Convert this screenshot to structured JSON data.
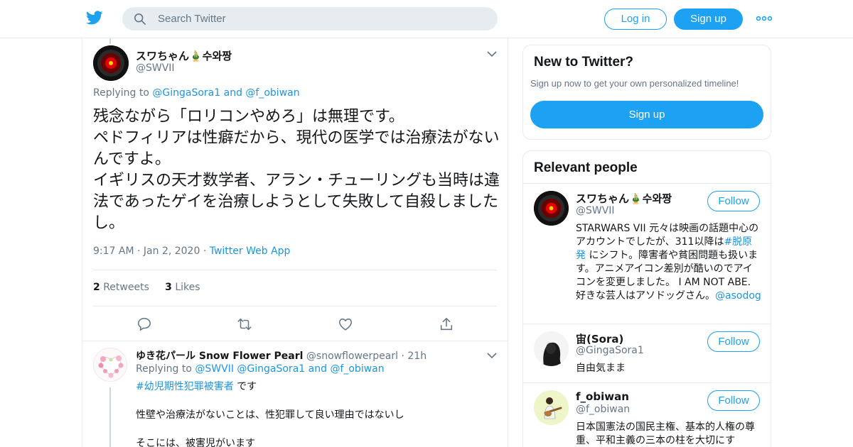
{
  "colors": {
    "accent": "#1da1f2",
    "link": "#1b95e0",
    "muted": "#657786"
  },
  "topbar": {
    "logo_icon": "twitter-bird-icon",
    "search_placeholder": "Search Twitter",
    "login_label": "Log in",
    "signup_label": "Sign up",
    "more_icon": "more-dots-icon"
  },
  "tweet": {
    "name": "スワちゃん🎍수와짱",
    "handle": "@SWVII",
    "replying_prefix": "Replying to",
    "replying_user1": "@GingaSora1",
    "replying_and": "and",
    "replying_user2": "@f_obiwan",
    "text": "残念ながら「ロリコンやめろ」は無理です。\nペドフィリアは性癖だから、現代の医学では治療法がないんですよ。\nイギリスの天才数学者、アラン・チューリングも当時は違法であったゲイを治療しようとして失敗して自殺しましたし。",
    "time": "9:17 AM",
    "date": "Jan 2, 2020",
    "source": "Twitter Web App",
    "retweets_count": "2",
    "retweets_label": "Retweets",
    "likes_count": "3",
    "likes_label": "Likes"
  },
  "reply": {
    "name": "ゆき花パール Snow Flower Pearl",
    "handle": "@snowflowerpearl",
    "time": "21h",
    "replying_prefix": "Replying to",
    "replying_users": "@SWVII @GingaSora1",
    "replying_and": "and",
    "replying_user3": "@f_obiwan",
    "hashtag": "#幼児期性犯罪被害者",
    "line1_suffix": " です",
    "line2": "性壁や治療法がないことは、性犯罪して良い理由ではないし",
    "line3": "そこには、被害児がいます"
  },
  "new_to_twitter": {
    "title": "New to Twitter?",
    "subtitle": "Sign up now to get your own personalized timeline!",
    "button": "Sign up"
  },
  "relevant": {
    "title": "Relevant people",
    "follow_label": "Follow",
    "people": [
      {
        "name": "スワちゃん🎍수와짱",
        "handle": "@SWVII",
        "bio_a": "STARWARS VII 元々は映画の話題中心のアカウントでしたが、311以降は",
        "bio_tag": "#脱原発",
        "bio_b": " にシフト。障害者や貧困問題も扱います。アニメアイコン差別が酷いのでアイコンを変更しました。 I AM NOT ABE. 好きな芸人はアソドッグさん。",
        "bio_mention": "@asodog"
      },
      {
        "name": "宙(Sora)",
        "handle": "@GingaSora1",
        "bio_a": "自由気まま"
      },
      {
        "name": "f_obiwan",
        "handle": "@f_obiwan",
        "bio_a": "日本国憲法の国民主権、基本的人権の尊重、平和主義の三本の柱を大切にす"
      }
    ]
  }
}
